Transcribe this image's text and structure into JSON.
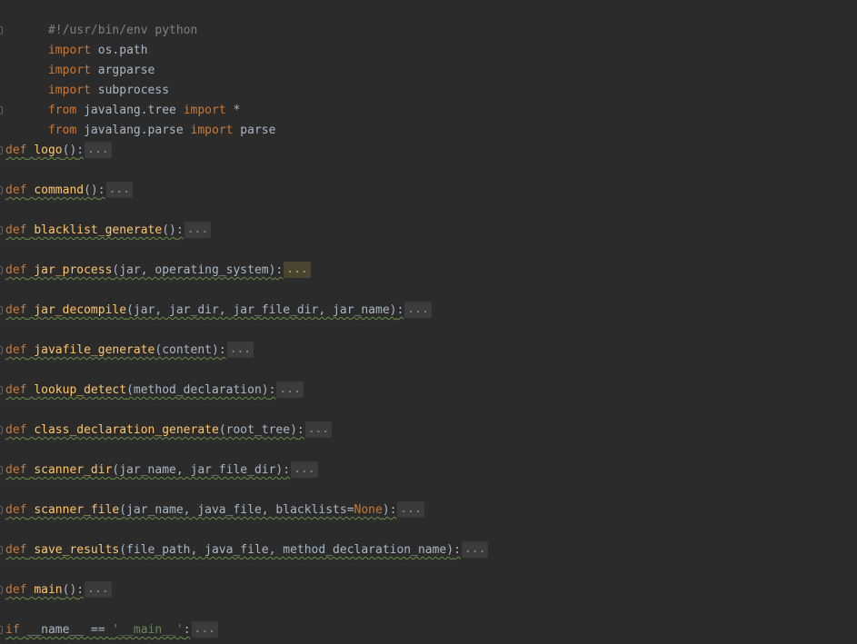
{
  "header": {
    "shebang": "#!/usr/bin/env python"
  },
  "imports": [
    {
      "kw1": "import",
      "module": " os.path",
      "kw2": "",
      "target": ""
    },
    {
      "kw1": "import",
      "module": " argparse",
      "kw2": "",
      "target": ""
    },
    {
      "kw1": "import",
      "module": " subprocess",
      "kw2": "",
      "target": ""
    },
    {
      "kw1": "from",
      "module": " javalang.tree ",
      "kw2": "import",
      "target": " *"
    },
    {
      "kw1": "from",
      "module": " javalang.parse ",
      "kw2": "import",
      "target": " parse"
    }
  ],
  "functions": [
    {
      "def": "def",
      "name": "logo",
      "params": "()",
      "colon": ":",
      "fold": "..."
    },
    {
      "def": "def",
      "name": "command",
      "params": "()",
      "colon": ":",
      "fold": "..."
    },
    {
      "def": "def",
      "name": "blacklist_generate",
      "params": "()",
      "colon": ":",
      "fold": "..."
    },
    {
      "def": "def",
      "name": "jar_process",
      "params": "(jar, operating_system)",
      "colon": ":",
      "fold": "..."
    },
    {
      "def": "def",
      "name": "jar_decompile",
      "params": "(jar, jar_dir, jar_file_dir, jar_name)",
      "colon": ":",
      "fold": "..."
    },
    {
      "def": "def",
      "name": "javafile_generate",
      "params": "(content)",
      "colon": ":",
      "fold": "..."
    },
    {
      "def": "def",
      "name": "lookup_detect",
      "params": "(method_declaration)",
      "colon": ":",
      "fold": "..."
    },
    {
      "def": "def",
      "name": "class_declaration_generate",
      "params": "(root_tree)",
      "colon": ":",
      "fold": "..."
    },
    {
      "def": "def",
      "name": "scanner_dir",
      "params": "(jar_name, jar_file_dir)",
      "colon": ":",
      "fold": "..."
    },
    {
      "def": "def",
      "name": "scanner_file",
      "params": "(jar_name, java_file, blacklists=",
      "param_default": "None",
      "params_end": ")",
      "colon": ":",
      "fold": "..."
    },
    {
      "def": "def",
      "name": "save_results",
      "params": "(file_path, java_file, method_declaration_name)",
      "colon": ":",
      "fold": "..."
    },
    {
      "def": "def",
      "name": "main",
      "params": "()",
      "colon": ":",
      "fold": "..."
    }
  ],
  "main_guard": {
    "kw": "if",
    "expr": " __name__ == ",
    "str": "'__main__'",
    "colon": ":",
    "fold": "..."
  }
}
